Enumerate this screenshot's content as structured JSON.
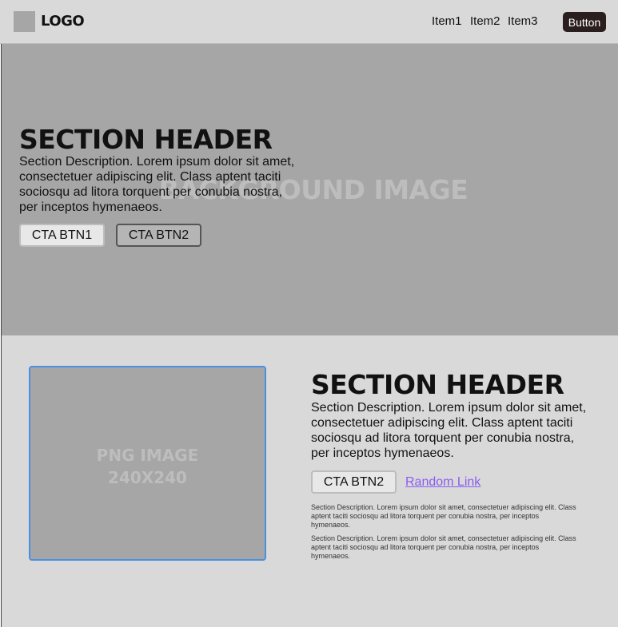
{
  "navbar": {
    "logo_text": "LOGO",
    "items": [
      {
        "label": "Item1"
      },
      {
        "label": "Item2"
      },
      {
        "label": "Item3"
      }
    ],
    "button_label": "Button"
  },
  "hero": {
    "background_label": "BACKGROUND IMAGE",
    "title": "SECTION HEADER",
    "description": "Section Description. Lorem ipsum dolor sit amet, consectetuer adipiscing elit. Class aptent taciti sociosqu ad litora torquent per conubia nostra, per inceptos hymenaeos.",
    "cta1_label": "CTA BTN1",
    "cta2_label": "CTA BTN2"
  },
  "feature": {
    "image_label_line1": "PNG IMAGE",
    "image_label_line2": "240X240",
    "title": "SECTION HEADER",
    "description": "Section Description. Lorem ipsum dolor sit amet, consectetuer adipiscing elit. Class aptent taciti sociosqu ad litora torquent per conubia nostra, per inceptos hymenaeos.",
    "cta_label": "CTA BTN2",
    "link_label": "Random Link",
    "small_paragraphs": [
      "Section Description. Lorem ipsum dolor sit amet, consectetuer adipiscing elit. Class aptent taciti sociosqu ad litora torquent per conubia nostra, per inceptos hymenaeos.",
      "Section Description. Lorem ipsum dolor sit amet, consectetuer adipiscing elit. Class aptent taciti sociosqu ad litora torquent per conubia nostra, per inceptos hymenaeos."
    ]
  },
  "colors": {
    "nav_bg": "#d9d9d9",
    "hero_bg": "#a6a6a6",
    "nav_button_bg": "#2b1e1e",
    "image_border": "#4a90e2",
    "link": "#8a5cf0"
  }
}
